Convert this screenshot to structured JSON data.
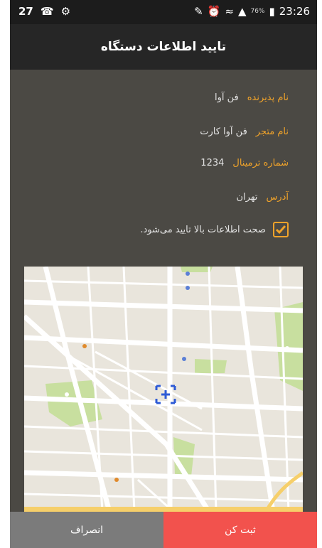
{
  "status_bar": {
    "left_number": "27",
    "right_time": "23:26",
    "battery": "76%"
  },
  "title": "تایید اطلاعات دستگاه",
  "fields": [
    {
      "label": "نام پذیرنده",
      "value": "فن آوا"
    },
    {
      "label": "نام متجر",
      "value": "فن آوا کارت"
    },
    {
      "label": "شماره ترمینال",
      "value": "1234"
    },
    {
      "label": "آدرس",
      "value": "تهران"
    }
  ],
  "confirm": {
    "label": "صحت اطلاعات بالا تایید می‌شود.",
    "checked": true
  },
  "buttons": {
    "submit": "ثبت کن",
    "cancel": "انصراف"
  },
  "colors": {
    "accent": "#f0a32a",
    "submit_bg": "#f2524d",
    "cancel_bg": "#7b7b7b"
  }
}
